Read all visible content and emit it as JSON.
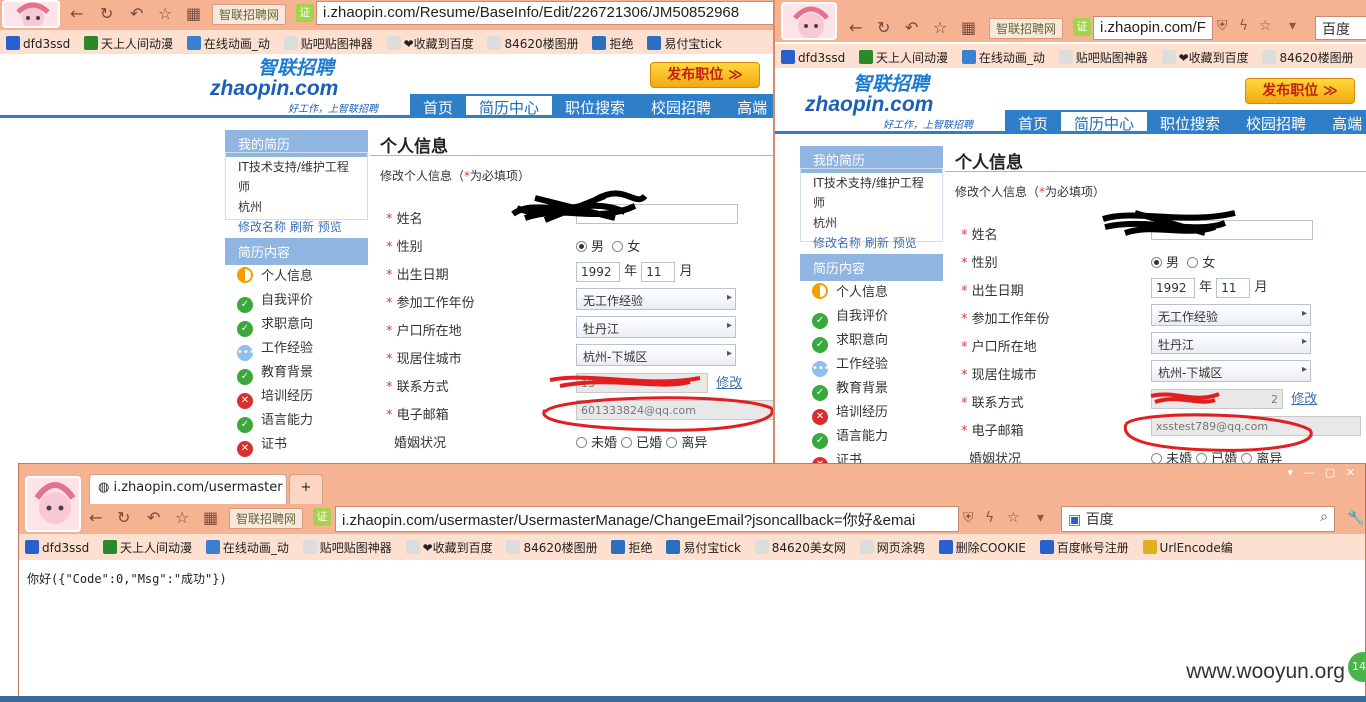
{
  "browser": {
    "site_chip": "智联招聘网",
    "cert_label": "证",
    "left_url": "i.zhaopin.com/Resume/BaseInfo/Edit/226721306/JM50852968",
    "right_url": "i.zhaopin.com/F",
    "right_search_label": "百度",
    "bottom_tab_title": "i.zhaopin.com/usermaster",
    "bottom_url": "i.zhaopin.com/usermaster/UsermasterManage/ChangeEmail?jsoncallback=你好&emai",
    "bottom_search": "百度",
    "bookmarks": [
      "dfd3ssd",
      "天上人间动漫",
      "在线动画_动",
      "贴吧贴图神器",
      "❤收藏到百度",
      "84620楼图册",
      "拒绝",
      "易付宝tick",
      "84620美女网",
      "网页涂鸦",
      "删除COOKIE",
      "百度帐号注册",
      "UrlEncode编"
    ],
    "bookmark_icon_colors": [
      "#2a5fcf",
      "#2a8a2a",
      "#3b7fd0",
      "#d9d9d9",
      "#d9d9d9",
      "#d9d9d9",
      "#2a6fc0",
      "#2a6fc0",
      "#d9d9d9",
      "#d9d9d9",
      "#2a5fcf",
      "#2a5fcf",
      "#e0b020"
    ]
  },
  "site": {
    "logo_cn": "智联招聘",
    "logo_en": "zhaopin.com",
    "slogan": "好工作，上智联招聘",
    "publish_button": "发布职位 ≫",
    "nav": [
      "首页",
      "简历中心",
      "职位搜索",
      "校园招聘",
      "高端"
    ]
  },
  "sidebar": {
    "my_resume_title": "我的简历",
    "resume_name": "IT技术支持/维护工程师",
    "resume_city": "杭州",
    "actions": [
      "修改名称",
      "刷新",
      "预览"
    ],
    "content_title": "简历内容",
    "sections": [
      {
        "label": "个人信息",
        "status": "half"
      },
      {
        "label": "自我评价",
        "status": "ok"
      },
      {
        "label": "求职意向",
        "status": "ok"
      },
      {
        "label": "工作经验",
        "status": "dots"
      },
      {
        "label": "教育背景",
        "status": "ok"
      },
      {
        "label": "培训经历",
        "status": "err"
      },
      {
        "label": "语言能力",
        "status": "ok"
      },
      {
        "label": "证书",
        "status": "err"
      }
    ]
  },
  "form": {
    "title": "个人信息",
    "subtitle_prefix": "修改个人信息（",
    "subtitle_star": "*",
    "subtitle_suffix": "为必填项）",
    "labels": {
      "name": "姓名",
      "gender": "性别",
      "birth": "出生日期",
      "work_years": "参加工作年份",
      "hukou": "户口所在地",
      "residence": "现居住城市",
      "contact": "联系方式",
      "email": "电子邮箱",
      "marital": "婚姻状况"
    },
    "gender_options": [
      "男",
      "女"
    ],
    "birth_year": "1992",
    "birth_year_unit": "年",
    "birth_month": "11",
    "birth_month_unit": "月",
    "work_years_value": "无工作经验",
    "hukou_value": "牡丹江",
    "residence_value": "杭州-下城区",
    "edit_link": "修改",
    "marital_options": [
      "未婚",
      "已婚",
      "离异"
    ],
    "left_contact_partial": "13",
    "right_contact_partial": "2",
    "left_email": "601333824@qq.com",
    "right_email": "xsstest789@qq.com"
  },
  "response": {
    "body": "你好({\"Code\":0,\"Msg\":\"成功\"})"
  },
  "watermark": "www.wooyun.org",
  "badge": "14"
}
